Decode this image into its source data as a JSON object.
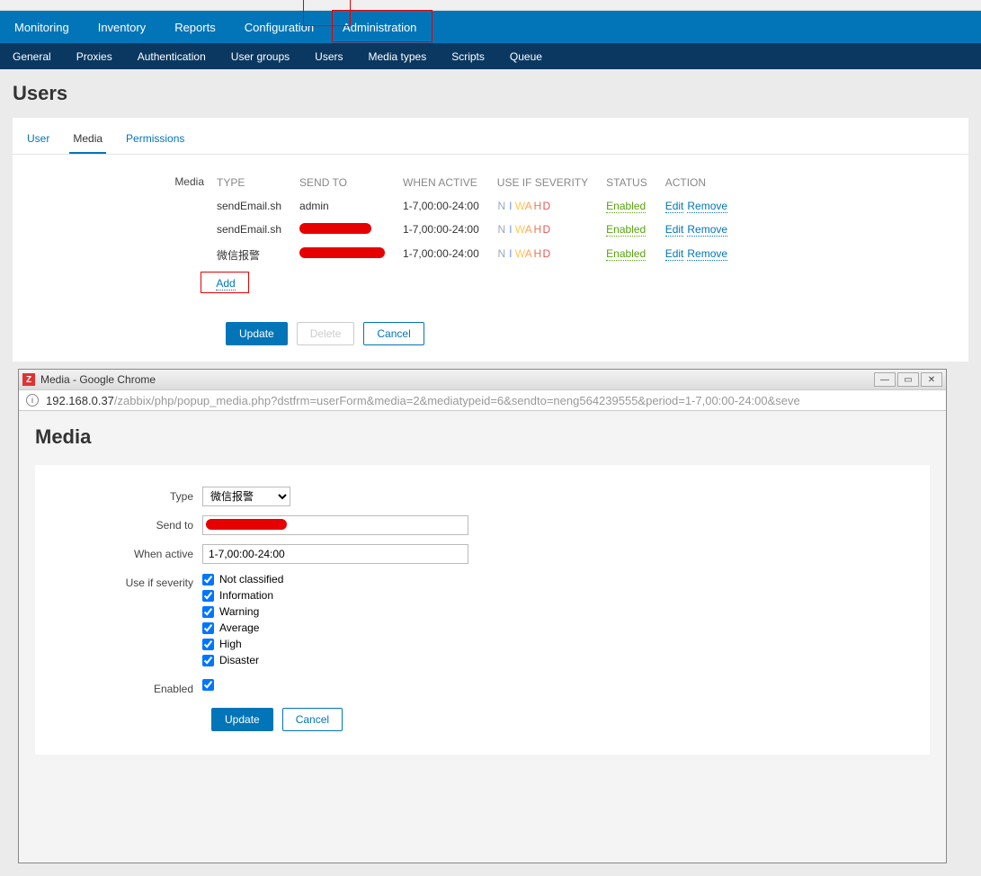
{
  "primary_nav": {
    "items": [
      {
        "label": "Monitoring"
      },
      {
        "label": "Inventory"
      },
      {
        "label": "Reports"
      },
      {
        "label": "Configuration"
      },
      {
        "label": "Administration"
      }
    ],
    "active_index": 4
  },
  "secondary_nav": {
    "items": [
      {
        "label": "General"
      },
      {
        "label": "Proxies"
      },
      {
        "label": "Authentication"
      },
      {
        "label": "User groups"
      },
      {
        "label": "Users"
      },
      {
        "label": "Media types"
      },
      {
        "label": "Scripts"
      },
      {
        "label": "Queue"
      }
    ],
    "active_index": 4
  },
  "page_title": "Users",
  "tabs": {
    "items": [
      {
        "label": "User"
      },
      {
        "label": "Media"
      },
      {
        "label": "Permissions"
      }
    ],
    "active_index": 1
  },
  "media_section_label": "Media",
  "media_table": {
    "headers": {
      "type": "TYPE",
      "send_to": "SEND TO",
      "when_active": "WHEN ACTIVE",
      "use_if_severity": "USE IF SEVERITY",
      "status": "STATUS",
      "action": "ACTION"
    },
    "rows": [
      {
        "type": "sendEmail.sh",
        "send_to": "admin",
        "when_active": "1-7,00:00-24:00",
        "use_if_severity": "NIWAHD",
        "status": "Enabled"
      },
      {
        "type": "sendEmail.sh",
        "send_to": "[redacted]",
        "when_active": "1-7,00:00-24:00",
        "use_if_severity": "NIWAHD",
        "status": "Enabled"
      },
      {
        "type": "微信报警",
        "send_to": "[redacted]",
        "when_active": "1-7,00:00-24:00",
        "use_if_severity": "NIWAHD",
        "status": "Enabled"
      }
    ],
    "edit_label": "Edit",
    "remove_label": "Remove",
    "add_label": "Add"
  },
  "main_buttons": {
    "update": "Update",
    "delete": "Delete",
    "cancel": "Cancel"
  },
  "popup": {
    "window_title": "Media - Google Chrome",
    "url_host": "192.168.0.37",
    "url_path": "/zabbix/php/popup_media.php?dstfrm=userForm&media=2&mediatypeid=6&sendto=neng564239555&period=1-7,00:00-24:00&seve",
    "title": "Media",
    "form": {
      "type_label": "Type",
      "type_value": "微信报警",
      "send_to_label": "Send to",
      "send_to_value": "",
      "when_active_label": "When active",
      "when_active_value": "1-7,00:00-24:00",
      "severity_label": "Use if severity",
      "severities": [
        {
          "label": "Not classified",
          "checked": true
        },
        {
          "label": "Information",
          "checked": true
        },
        {
          "label": "Warning",
          "checked": true
        },
        {
          "label": "Average",
          "checked": true
        },
        {
          "label": "High",
          "checked": true
        },
        {
          "label": "Disaster",
          "checked": true
        }
      ],
      "enabled_label": "Enabled",
      "enabled_checked": true,
      "update": "Update",
      "cancel": "Cancel"
    }
  }
}
